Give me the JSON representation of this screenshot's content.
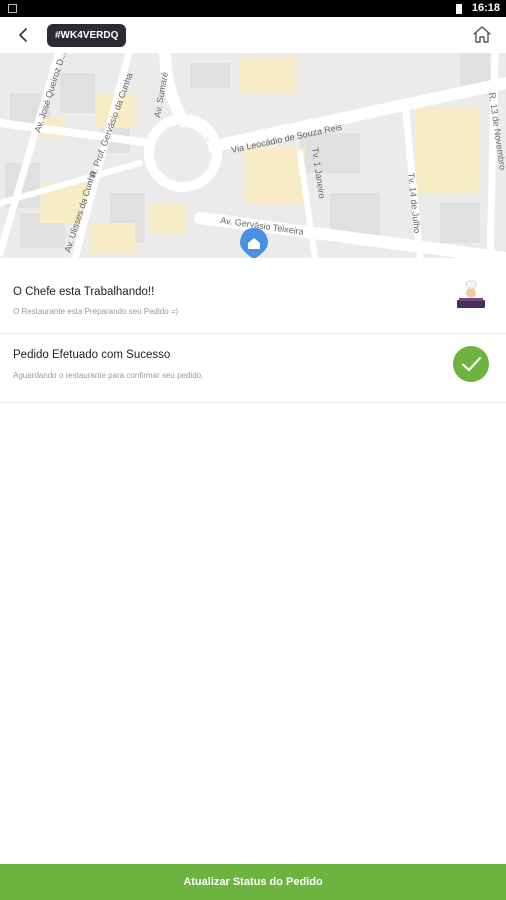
{
  "statusbar": {
    "time": "16:18"
  },
  "header": {
    "order_code": "#WK4VERDQ",
    "back_icon": "arrow-left-icon",
    "home_icon": "home-icon"
  },
  "map": {
    "streets": [
      "Av. José Queiroz D...",
      "R. Prof. Gervásio da Cunha",
      "Av. Sumaré",
      "Via Leocádio de Souza Reis",
      "R. 13 de Novembro",
      "Tv. 1 Janeiro",
      "Tv. 14 de Julho",
      "Av. Gervásio Teixeira",
      "Av. Ulisses da Cunha"
    ],
    "marker_icon": "location-pin-icon"
  },
  "status_items": [
    {
      "title": "O Chefe esta Trabalhando!!",
      "subtitle": "O Restaurante esta Preparando seu Pedido =)",
      "icon": "chef-icon"
    },
    {
      "title": "Pedido Efetuado com Sucesso",
      "subtitle": "Aguardando o restaurante para confirmar seu pedido.",
      "icon": "check-icon"
    }
  ],
  "footer": {
    "update_button": "Atualizar Status do Pedido"
  },
  "colors": {
    "accent": "#6cb33f",
    "badge": "#2b2b33",
    "map_bg": "#eeeeee",
    "marker": "#4a90e2"
  }
}
